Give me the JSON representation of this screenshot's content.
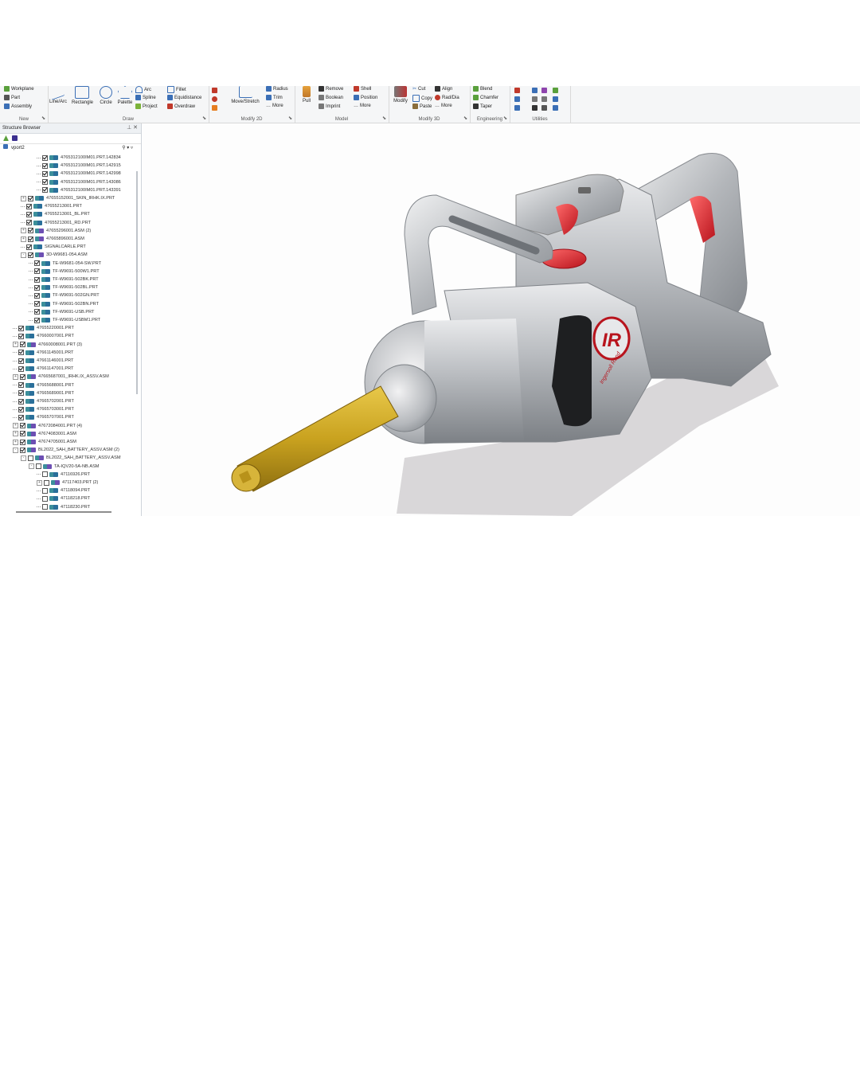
{
  "ribbon": {
    "groups": [
      {
        "label": "New"
      },
      {
        "label": "Draw"
      },
      {
        "label": "Modify 2D"
      },
      {
        "label": "Model"
      },
      {
        "label": "Modify 3D"
      },
      {
        "label": "Engineering"
      },
      {
        "label": "Utilities"
      }
    ],
    "new": {
      "workplane": "Workplane",
      "part": "Part",
      "assembly": "Assembly"
    },
    "draw": {
      "line_arc": "Line/Arc",
      "rectangle": "Rectangle",
      "circle": "Circle",
      "palette": "Palette",
      "arc": "Arc",
      "spline": "Spline",
      "project": "Project",
      "fillet": "Fillet",
      "equidistance": "Equidistance",
      "overdraw": "Overdraw"
    },
    "modify2d": {
      "move_stretch": "Move/Stretch",
      "radius": "Radius",
      "trim": "Trim",
      "more": "More"
    },
    "model": {
      "pull": "Pull",
      "remove": "Remove",
      "boolean": "Boolean",
      "imprint": "Imprint",
      "shell": "Shell",
      "position": "Position",
      "more": "More"
    },
    "modify3d": {
      "modify": "Modify",
      "cut": "Cut",
      "copy": "Copy",
      "paste": "Paste",
      "align": "Align",
      "rad_dia": "Rad/Dia",
      "more": "More"
    },
    "engineering": {
      "blend": "Blend",
      "chamfer": "Chamfer",
      "taper": "Taper"
    }
  },
  "browser": {
    "title": "Structure Browser",
    "root": "vport2",
    "rows": [
      {
        "label": "4765312100IM01.PRT.142834",
        "level": 4,
        "checked": true,
        "type": "part",
        "expander": ""
      },
      {
        "label": "4765312100IM01.PRT.142915",
        "level": 4,
        "checked": true,
        "type": "part",
        "expander": ""
      },
      {
        "label": "4765312100IM01.PRT.142998",
        "level": 4,
        "checked": true,
        "type": "part",
        "expander": ""
      },
      {
        "label": "4765312100IM01.PRT.143086",
        "level": 4,
        "checked": true,
        "type": "part",
        "expander": ""
      },
      {
        "label": "4765312100IM01.PRT.143391",
        "level": 4,
        "checked": true,
        "type": "part",
        "expander": ""
      },
      {
        "label": "47655152001_SKIN_IRHK.IX.PRT",
        "level": 2,
        "checked": true,
        "type": "part",
        "expander": "+"
      },
      {
        "label": "47655213001.PRT",
        "level": 2,
        "checked": true,
        "type": "part",
        "expander": ""
      },
      {
        "label": "47655213001_BL.PRT",
        "level": 2,
        "checked": true,
        "type": "part",
        "expander": ""
      },
      {
        "label": "47655213001_RD.PRT",
        "level": 2,
        "checked": true,
        "type": "part",
        "expander": ""
      },
      {
        "label": "47655296001.ASM (2)",
        "level": 2,
        "checked": true,
        "type": "asm",
        "expander": "+"
      },
      {
        "label": "47665896001.ASM",
        "level": 2,
        "checked": true,
        "type": "asm",
        "expander": "+"
      },
      {
        "label": "SIGNALCARLE.PRT",
        "level": 2,
        "checked": true,
        "type": "part",
        "expander": ""
      },
      {
        "label": "3D-W9681-054.ASM",
        "level": 2,
        "checked": true,
        "type": "asm",
        "expander": "-"
      },
      {
        "label": "TE-W9681-054-SW.PRT",
        "level": 3,
        "checked": true,
        "type": "part",
        "expander": ""
      },
      {
        "label": "TF-W9691-500W1.PRT",
        "level": 3,
        "checked": true,
        "type": "part",
        "expander": ""
      },
      {
        "label": "TF-W9691-502BK.PRT",
        "level": 3,
        "checked": true,
        "type": "part",
        "expander": ""
      },
      {
        "label": "TF-W9691-502BL.PRT",
        "level": 3,
        "checked": true,
        "type": "part",
        "expander": ""
      },
      {
        "label": "TF-W9691-502GN.PRT",
        "level": 3,
        "checked": true,
        "type": "part",
        "expander": ""
      },
      {
        "label": "TF-W9691-502BN.PRT",
        "level": 3,
        "checked": true,
        "type": "part",
        "expander": ""
      },
      {
        "label": "TF-W9691-USB.PRT",
        "level": 3,
        "checked": true,
        "type": "part",
        "expander": ""
      },
      {
        "label": "TF-W9691-USBM1.PRT",
        "level": 3,
        "checked": true,
        "type": "part",
        "expander": ""
      },
      {
        "label": "47655220001.PRT",
        "level": 1,
        "checked": true,
        "type": "part",
        "expander": ""
      },
      {
        "label": "47660007001.PRT",
        "level": 1,
        "checked": true,
        "type": "part",
        "expander": ""
      },
      {
        "label": "47660008001.PRT (3)",
        "level": 1,
        "checked": true,
        "type": "asm",
        "expander": "+"
      },
      {
        "label": "47661145001.PRT",
        "level": 1,
        "checked": true,
        "type": "part",
        "expander": ""
      },
      {
        "label": "47661146001.PRT",
        "level": 1,
        "checked": true,
        "type": "part",
        "expander": ""
      },
      {
        "label": "47661147001.PRT",
        "level": 1,
        "checked": true,
        "type": "part",
        "expander": ""
      },
      {
        "label": "47665687001_IRHK.IX_ASSV.ASM",
        "level": 1,
        "checked": true,
        "type": "asm",
        "expander": "+"
      },
      {
        "label": "47665688001.PRT",
        "level": 1,
        "checked": true,
        "type": "part",
        "expander": ""
      },
      {
        "label": "47665689001.PRT",
        "level": 1,
        "checked": true,
        "type": "part",
        "expander": ""
      },
      {
        "label": "47665702001.PRT",
        "level": 1,
        "checked": true,
        "type": "part",
        "expander": ""
      },
      {
        "label": "47665703001.PRT",
        "level": 1,
        "checked": true,
        "type": "part",
        "expander": ""
      },
      {
        "label": "47665707001.PRT",
        "level": 1,
        "checked": true,
        "type": "part",
        "expander": ""
      },
      {
        "label": "47672084001.PRT (4)",
        "level": 1,
        "checked": true,
        "type": "asm",
        "expander": "+"
      },
      {
        "label": "47674083001.ASM",
        "level": 1,
        "checked": true,
        "type": "asm",
        "expander": "+"
      },
      {
        "label": "47674705001.ASM",
        "level": 1,
        "checked": true,
        "type": "asm",
        "expander": "+"
      },
      {
        "label": "BL2022_SAH_BATTERY_ASSV.ASM (2)",
        "level": 1,
        "checked": true,
        "type": "asm",
        "expander": "-"
      },
      {
        "label": "BL2022_SAH_BATTERY_ASSV.ASM",
        "level": 2,
        "checked": false,
        "type": "asm",
        "expander": "-"
      },
      {
        "label": "TA-IQV20-5A-NB.ASM",
        "level": 3,
        "checked": false,
        "type": "asm",
        "expander": "-"
      },
      {
        "label": "47116926.PRT",
        "level": 4,
        "checked": false,
        "type": "part",
        "expander": ""
      },
      {
        "label": "47117403.PRT (2)",
        "level": 4,
        "checked": false,
        "type": "asm",
        "expander": "+"
      },
      {
        "label": "47118094.PRT",
        "level": 4,
        "checked": false,
        "type": "part",
        "expander": ""
      },
      {
        "label": "47118218.PRT",
        "level": 4,
        "checked": false,
        "type": "part",
        "expander": ""
      },
      {
        "label": "47118230.PRT",
        "level": 4,
        "checked": false,
        "type": "part",
        "expander": ""
      }
    ]
  },
  "viewport": {
    "logo_text": "IR",
    "brand_text": "Ingersoll Rand"
  },
  "colors": {
    "body_metal": "#b9bcc0",
    "accent_red": "#d9232d",
    "anvil_gold": "#c9a21f"
  }
}
